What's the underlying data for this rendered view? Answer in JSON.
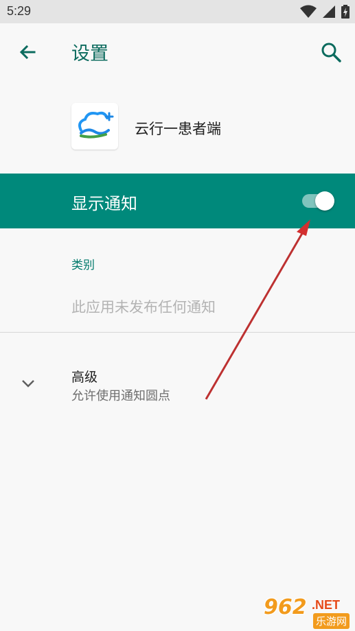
{
  "status_bar": {
    "time": "5:29",
    "icons": [
      "wifi-icon",
      "signal-icon",
      "battery-charging-icon"
    ]
  },
  "toolbar": {
    "back_icon": "arrow-left-icon",
    "title": "设置",
    "search_icon": "search-icon"
  },
  "app": {
    "name": "云行一患者端",
    "icon": "cloud-plus-app-icon"
  },
  "notifications": {
    "main_switch_label": "显示通知",
    "main_switch_on": true
  },
  "category": {
    "header": "类别",
    "empty_text": "此应用未发布任何通知"
  },
  "advanced": {
    "title": "高级",
    "subtitle": "允许使用通知圆点",
    "icon": "chevron-down-icon"
  },
  "watermark": {
    "brand": "962",
    "suffix": ".NET",
    "sub": "乐游网"
  },
  "colors": {
    "accent": "#00897b",
    "accent_dark": "#00796b",
    "annotation_arrow": "#d32f2f"
  }
}
